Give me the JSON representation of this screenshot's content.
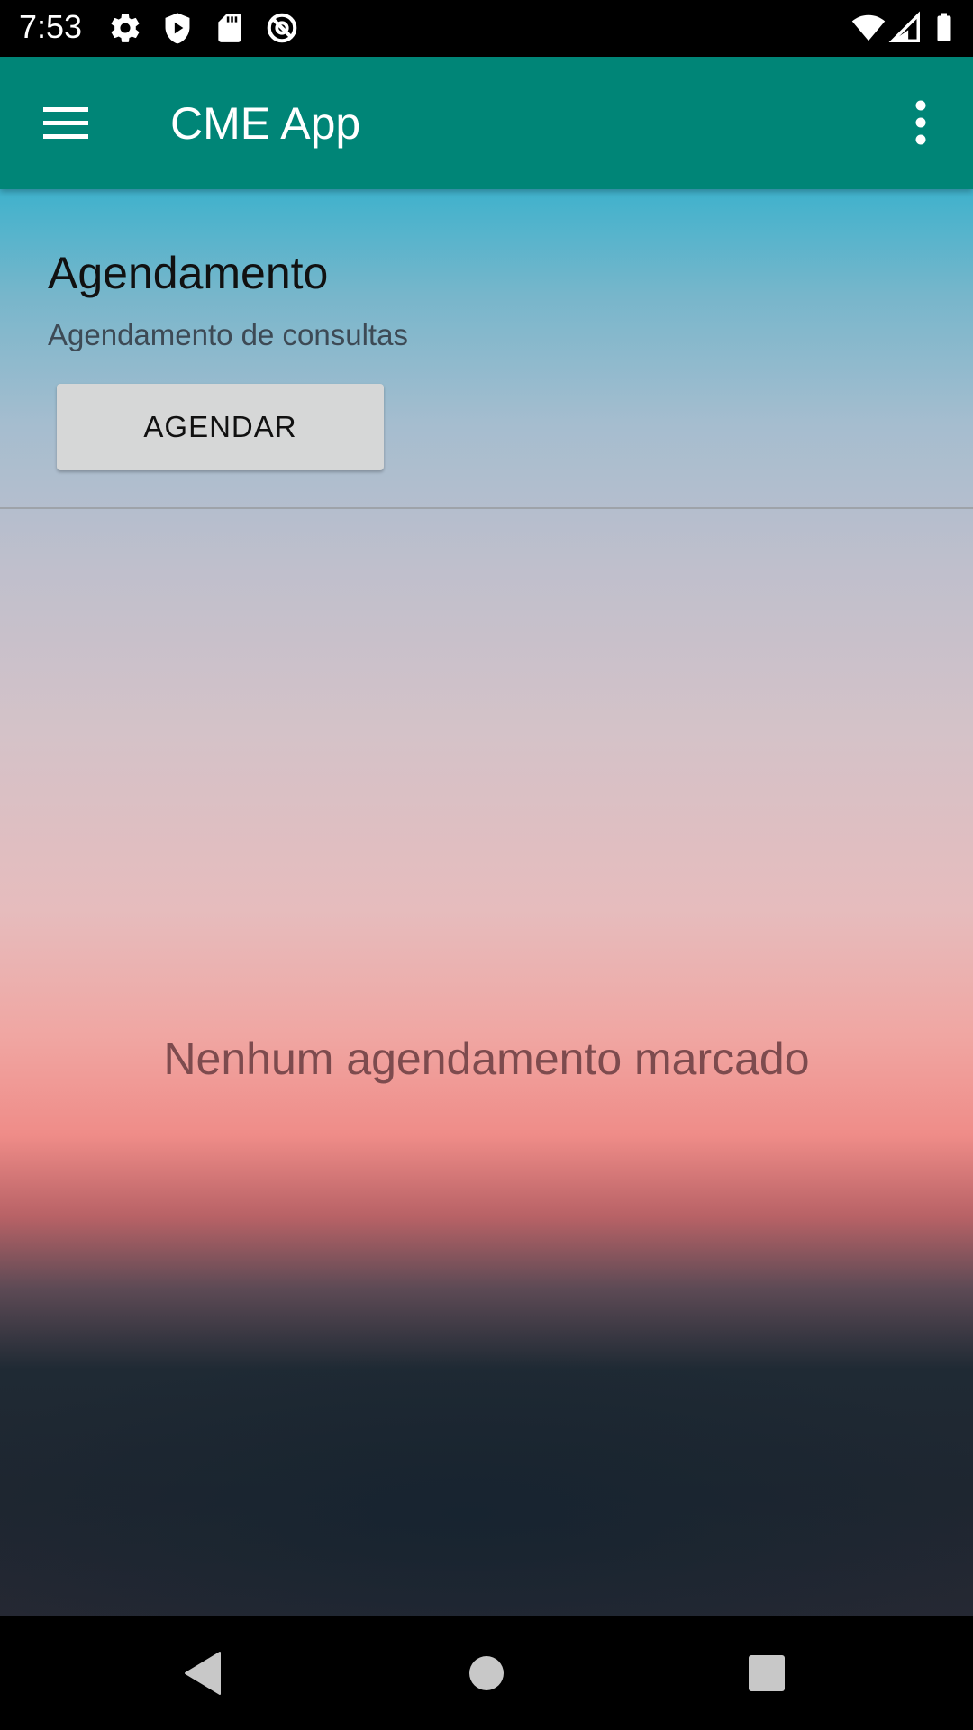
{
  "status_bar": {
    "time": "7:53",
    "left_icons": [
      "gear-icon",
      "shield-play-icon",
      "sd-card-icon",
      "no-data-icon"
    ],
    "right_icons": [
      "wifi-icon",
      "cell-signal-icon",
      "battery-icon"
    ]
  },
  "app_bar": {
    "title": "CME App",
    "background_color": "#008577",
    "menu_icon": "hamburger-menu-icon",
    "overflow_icon": "more-vert-icon"
  },
  "section": {
    "title": "Agendamento",
    "subtitle": "Agendamento de consultas",
    "button_label": "AGENDAR"
  },
  "list": {
    "empty_message": "Nenhum agendamento marcado"
  },
  "nav_bar": {
    "buttons": [
      "back-icon",
      "home-icon",
      "recents-icon"
    ]
  }
}
